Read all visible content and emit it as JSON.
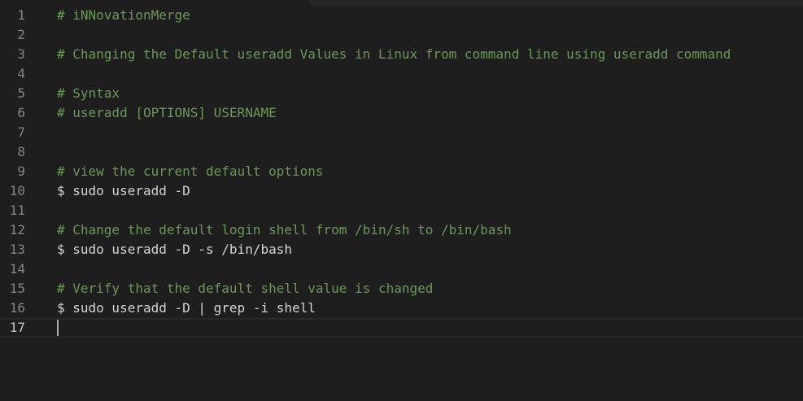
{
  "editor": {
    "lines": [
      {
        "number": "1",
        "text": "# iNNovationMerge",
        "kind": "comment"
      },
      {
        "number": "2",
        "text": "",
        "kind": "plain"
      },
      {
        "number": "3",
        "text": "# Changing the Default useradd Values in Linux from command line using useradd command",
        "kind": "comment"
      },
      {
        "number": "4",
        "text": "",
        "kind": "plain"
      },
      {
        "number": "5",
        "text": "# Syntax",
        "kind": "comment"
      },
      {
        "number": "6",
        "text": "# useradd [OPTIONS] USERNAME",
        "kind": "comment"
      },
      {
        "number": "7",
        "text": "",
        "kind": "plain"
      },
      {
        "number": "8",
        "text": "",
        "kind": "plain"
      },
      {
        "number": "9",
        "text": "# view the current default options",
        "kind": "comment"
      },
      {
        "number": "10",
        "text": "$ sudo useradd -D",
        "kind": "plain"
      },
      {
        "number": "11",
        "text": "",
        "kind": "plain"
      },
      {
        "number": "12",
        "text": "# Change the default login shell from /bin/sh to /bin/bash",
        "kind": "comment"
      },
      {
        "number": "13",
        "text": "$ sudo useradd -D -s /bin/bash",
        "kind": "plain"
      },
      {
        "number": "14",
        "text": "",
        "kind": "plain"
      },
      {
        "number": "15",
        "text": "# Verify that the default shell value is changed",
        "kind": "comment"
      },
      {
        "number": "16",
        "text": "$ sudo useradd -D | grep -i shell",
        "kind": "plain"
      },
      {
        "number": "17",
        "text": "",
        "kind": "current"
      }
    ],
    "colors": {
      "background": "#1e1e1e",
      "comment": "#6a9955",
      "text": "#d4d4d4",
      "line_number": "#858585"
    }
  }
}
